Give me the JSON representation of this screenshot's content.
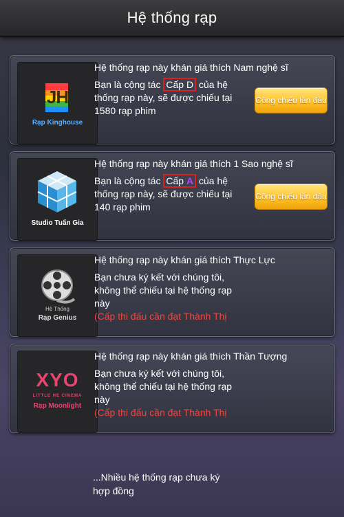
{
  "header": {
    "title": "Hệ thống rạp"
  },
  "cards": [
    {
      "logo_caption": "Rạp Kinghouse",
      "logo_text": "JH",
      "headline": "Hệ thống rạp này khán giá thích Nam nghệ sĩ",
      "line1_pre": "Bạn là cộng tác",
      "rank": "Cấp D",
      "line1_post": "của hệ",
      "line2": "thống rạp này, sẽ được chiếu tại",
      "line3": "1580 rạp phim",
      "button": "Công chiếu lần đầu"
    },
    {
      "logo_caption": "Studio Tuấn Gia",
      "headline": "Hệ thống rạp này khán giá thích 1 Sao nghệ sĩ",
      "line1_pre": "Bạn là cộng tác",
      "rank_word": "Cấp",
      "rank_letter": "A",
      "line1_post": "của hệ",
      "line2": "thống rạp này, sẽ được chiếu tại",
      "line3": "140 rạp phim",
      "button": "Công chiếu lần đầu"
    },
    {
      "logo_caption_top": "Hệ Thống",
      "logo_caption": "Rạp Genius",
      "headline": "Hệ thống rạp này khán giá thích Thực Lực",
      "line1": "Bạn chưa ký kết với chúng tôi,",
      "line2": "không thể chiếu tại hệ thống rạp",
      "line3": "này",
      "warning": "(Cấp thi đấu cần đạt Thành Thị"
    },
    {
      "logo_text": "XYO",
      "logo_sub": "LITTLE HE CINEMA",
      "logo_caption": "Rạp Moonlight",
      "headline": "Hệ thống rạp này khán giá thích Thần Tượng",
      "line1": "Bạn chưa ký kết với chúng tôi,",
      "line2": "không thể chiếu tại hệ thống rạp",
      "line3": "này",
      "warning": "(Cấp thi đấu cần đạt Thành Thị"
    }
  ],
  "footer": {
    "line1": "...Nhiều hệ thống rạp chưa ký",
    "line2": "hợp đồng"
  },
  "colors": {
    "button_yellow": "#ffc32a",
    "warning_red": "#f2443b",
    "highlight_box": "#e02020",
    "rank_a_purple": "#c040ff"
  }
}
